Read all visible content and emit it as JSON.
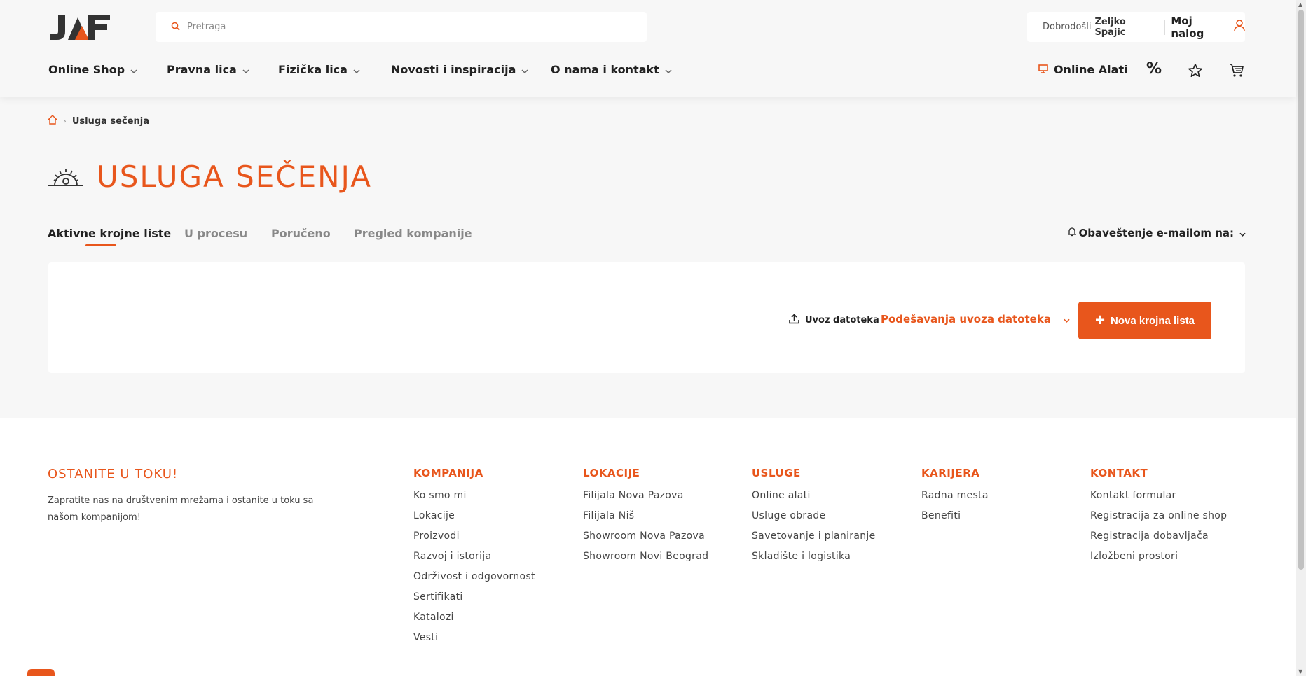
{
  "header": {
    "logo_text": "JAF",
    "search_placeholder": "Pretraga",
    "welcome": "Dobrodošli",
    "username": "Zeljko Spajic",
    "my_account": "Moj nalog"
  },
  "nav": {
    "items": [
      {
        "label": "Online Shop"
      },
      {
        "label": "Pravna lica"
      },
      {
        "label": "Fizička lica"
      },
      {
        "label": "Novosti i inspiracija"
      },
      {
        "label": "O nama i kontakt"
      }
    ],
    "online_tools": "Online Alati",
    "discount_symbol": "%"
  },
  "breadcrumb": {
    "current": "Usluga sečenja"
  },
  "page": {
    "title": "USLUGA SEČENJA"
  },
  "tabs": [
    {
      "label": "Aktivne krojne liste",
      "active": true
    },
    {
      "label": "U procesu",
      "active": false
    },
    {
      "label": "Poručeno",
      "active": false
    },
    {
      "label": "Pregled kompanije",
      "active": false
    }
  ],
  "notify": {
    "label": "Obaveštenje e-mailom na:"
  },
  "panel": {
    "import_label": "Uvoz datoteka",
    "import_settings": "Podešavanja uvoza datoteka",
    "new_button": "Nova krojna lista"
  },
  "footer": {
    "stay_title": "OSTANITE U TOKU!",
    "stay_text": "Zapratite nas na društvenim mrežama i ostanite u toku sa našom kompanijom!",
    "columns": [
      {
        "title": "KOMPANIJA",
        "links": [
          "Ko smo mi",
          "Lokacije",
          "Proizvodi",
          "Razvoj i istorija",
          "Održivost i odgovornost",
          "Sertifikati",
          "Katalozi",
          "Vesti"
        ]
      },
      {
        "title": "LOKACIJE",
        "links": [
          "Filijala Nova Pazova",
          "Filijala Niš",
          "Showroom Nova Pazova",
          "Showroom Novi Beograd"
        ]
      },
      {
        "title": "USLUGE",
        "links": [
          "Online alati",
          "Usluge obrade",
          "Savetovanje i planiranje",
          "Skladište i logistika"
        ]
      },
      {
        "title": "KARIJERA",
        "links": [
          "Radna mesta",
          "Benefiti"
        ]
      },
      {
        "title": "KONTAKT",
        "links": [
          "Kontakt formular",
          "Registracija za online shop",
          "Registracija dobavljača",
          "Izložbeni prostori"
        ]
      }
    ]
  },
  "colors": {
    "accent": "#e8561c",
    "background": "#f7f7f7",
    "text_dark": "#222222"
  }
}
